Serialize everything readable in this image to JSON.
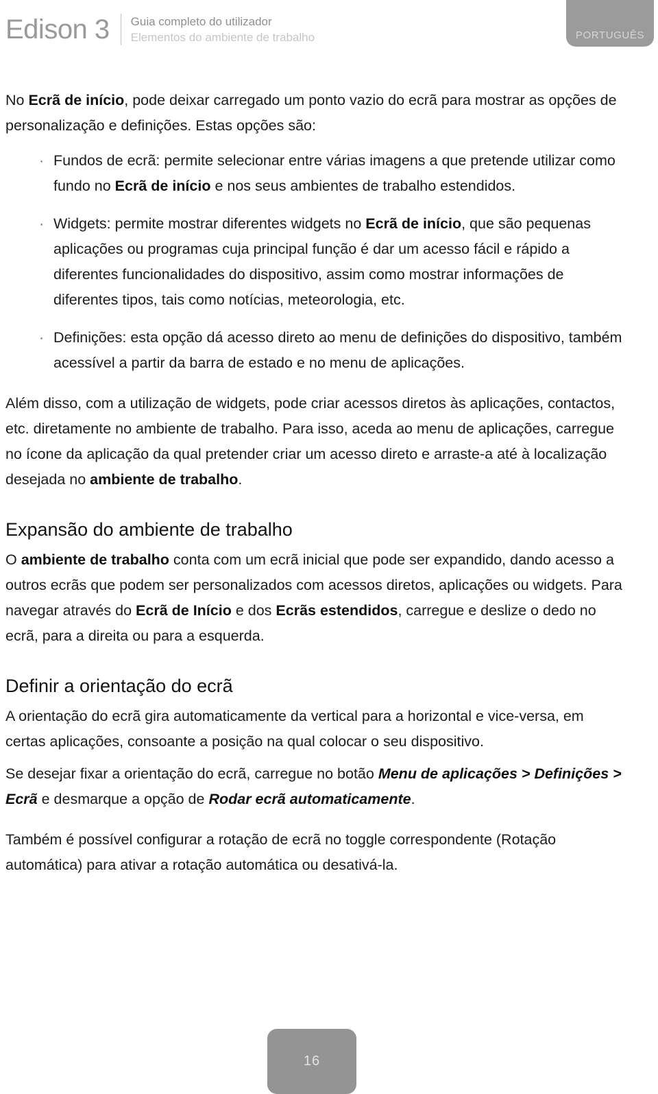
{
  "header": {
    "brand_title": "Edison 3",
    "subtitle_line1": "Guia completo do utilizador",
    "subtitle_line2": "Elementos do ambiente de trabalho",
    "language_tab": "PORTUGUÊS",
    "colors": {
      "brand_gray": "#9a9a9a",
      "subtitle_dark": "#8f8f8f",
      "subtitle_light": "#c6c6c6",
      "tab_background": "#9b9b9b",
      "tab_text": "#d6d6d6"
    }
  },
  "content": {
    "intro": {
      "part1": "No ",
      "bold1": "Ecrã de início",
      "part2": ", pode deixar carregado um ponto vazio do ecrã para mostrar as opções de personalização e definições. Estas opções são:"
    },
    "bullets": [
      {
        "marker": "·",
        "part1": "Fundos de ecrã: permite selecionar entre várias imagens a que pretende utilizar como fundo no ",
        "bold1": "Ecrã de início",
        "part2": " e nos seus ambientes de trabalho estendidos."
      },
      {
        "marker": "·",
        "part1": "Widgets: permite mostrar diferentes widgets no ",
        "bold1": "Ecrã de início",
        "part2": ", que são pequenas aplicações ou programas cuja principal função é dar um acesso fácil e rápido a diferentes funcionalidades do dispositivo, assim como mostrar informações de diferentes tipos, tais como notícias, meteorologia, etc."
      },
      {
        "marker": "·",
        "part1": "Definições: esta opção dá acesso direto ao menu de definições do dispositivo, também acessível a partir da barra de estado e no menu de aplicações.",
        "bold1": "",
        "part2": ""
      }
    ],
    "paragraph_after_bullets": {
      "part1": "Além disso, com a utilização de widgets, pode criar acessos diretos às aplicações, contactos, etc. diretamente no ambiente de trabalho. Para isso, aceda ao menu de aplicações, carregue no ícone da aplicação da qual pretender criar um acesso direto e arraste-a até à localização desejada no ",
      "bold1": "ambiente de trabalho",
      "part2": "."
    },
    "section_expansao": {
      "heading": "Expansão do ambiente de trabalho",
      "part1": "O ",
      "bold1": "ambiente de trabalho",
      "part2": " conta com um ecrã inicial que pode ser expandido, dando acesso a outros ecrãs que podem ser personalizados com acessos diretos, aplicações ou widgets. Para navegar através do ",
      "bold2": "Ecrã de Início",
      "part3": " e dos ",
      "bold3": "Ecrãs estendidos",
      "part4": ", carregue e deslize o dedo no ecrã, para a direita ou para a esquerda."
    },
    "section_orientacao": {
      "heading": "Definir a orientação do ecrã",
      "paragraph1": "A orientação do ecrã gira automaticamente da vertical para a horizontal e vice-versa, em certas aplicações, consoante a posição na qual colocar o seu dispositivo.",
      "paragraph2_part1": "Se desejar fixar a orientação do ecrã, carregue no botão ",
      "paragraph2_bolditalic1": "Menu de aplicações > Definições > Ecrã",
      "paragraph2_part2": " e desmarque a opção de ",
      "paragraph2_bolditalic2": "Rodar ecrã automaticamente",
      "paragraph2_part3": ".",
      "paragraph3": "Também é possível configurar a rotação de ecrã no toggle correspondente (Rotação automática) para ativar a rotação automática ou desativá-la."
    }
  },
  "footer": {
    "page_number": "16",
    "background_color": "#949494",
    "text_color": "#e3e3e3"
  }
}
